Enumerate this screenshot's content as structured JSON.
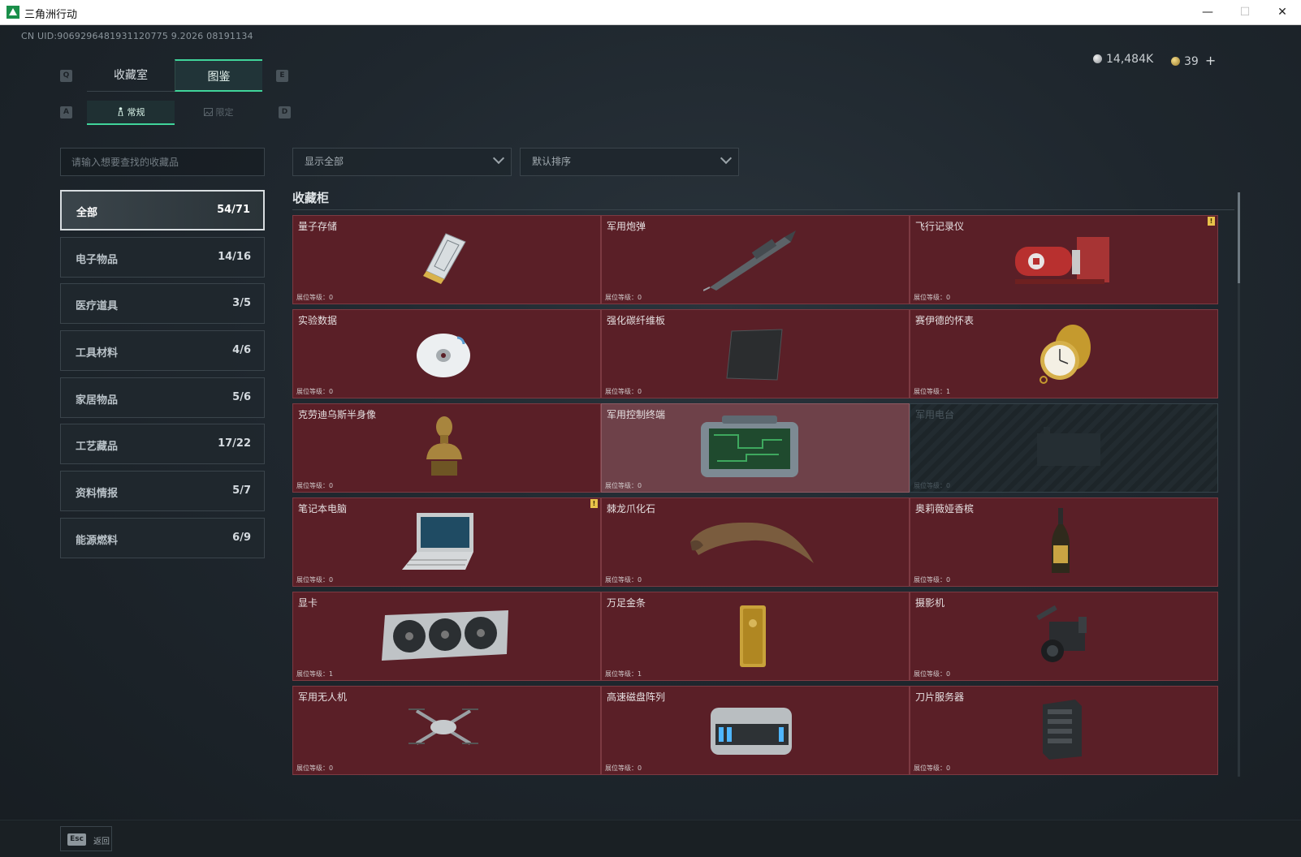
{
  "window": {
    "title": "三角洲行动",
    "minimize": "—",
    "maximize": "☐",
    "close": "✕"
  },
  "header": {
    "uid": "CN UID:9069296481931120775 9.2026 08191134",
    "silver": "14,484K",
    "gold": "39",
    "add": "+"
  },
  "tabs": {
    "key_left": "Q",
    "key_right": "E",
    "items": [
      {
        "label": "收藏室"
      },
      {
        "label": "图鉴"
      }
    ]
  },
  "subtabs": {
    "key_left": "A",
    "key_right": "D",
    "items": [
      {
        "label": "常规",
        "icon": "figure-icon"
      },
      {
        "label": "限定",
        "icon": "image-icon"
      }
    ]
  },
  "search": {
    "placeholder": "请输入想要查找的收藏品"
  },
  "filters": {
    "display": "显示全部",
    "sort": "默认排序"
  },
  "categories": [
    {
      "label": "全部",
      "count": "54/71"
    },
    {
      "label": "电子物品",
      "count": "14/16"
    },
    {
      "label": "医疗道具",
      "count": "3/5"
    },
    {
      "label": "工具材料",
      "count": "4/6"
    },
    {
      "label": "家居物品",
      "count": "5/6"
    },
    {
      "label": "工艺藏品",
      "count": "17/22"
    },
    {
      "label": "资料情报",
      "count": "5/7"
    },
    {
      "label": "能源燃料",
      "count": "6/9"
    }
  ],
  "section": {
    "title": "收藏柜"
  },
  "items": [
    {
      "name": "量子存储",
      "level": "展位等级：0"
    },
    {
      "name": "军用炮弹",
      "level": "展位等级：0"
    },
    {
      "name": "飞行记录仪",
      "level": "展位等级：0",
      "alert": "!"
    },
    {
      "name": "实验数据",
      "level": "展位等级：0"
    },
    {
      "name": "强化碳纤维板",
      "level": "展位等级：0"
    },
    {
      "name": "赛伊德的怀表",
      "level": "展位等级：1"
    },
    {
      "name": "克劳迪乌斯半身像",
      "level": "展位等级：0"
    },
    {
      "name": "军用控制终端",
      "level": "展位等级：0"
    },
    {
      "name": "军用电台",
      "level": "展位等级：0"
    },
    {
      "name": "笔记本电脑",
      "level": "展位等级：0",
      "alert": "!"
    },
    {
      "name": "棘龙爪化石",
      "level": "展位等级：0"
    },
    {
      "name": "奥莉薇娅香槟",
      "level": "展位等级：0"
    },
    {
      "name": "显卡",
      "level": "展位等级：1"
    },
    {
      "name": "万足金条",
      "level": "展位等级：1"
    },
    {
      "name": "摄影机",
      "level": "展位等级：0"
    },
    {
      "name": "军用无人机",
      "level": "展位等级：0"
    },
    {
      "name": "高速磁盘阵列",
      "level": "展位等级：0"
    },
    {
      "name": "刀片服务器",
      "level": "展位等级：0"
    }
  ],
  "footer": {
    "esc_key": "Esc",
    "back_label": "返回"
  }
}
